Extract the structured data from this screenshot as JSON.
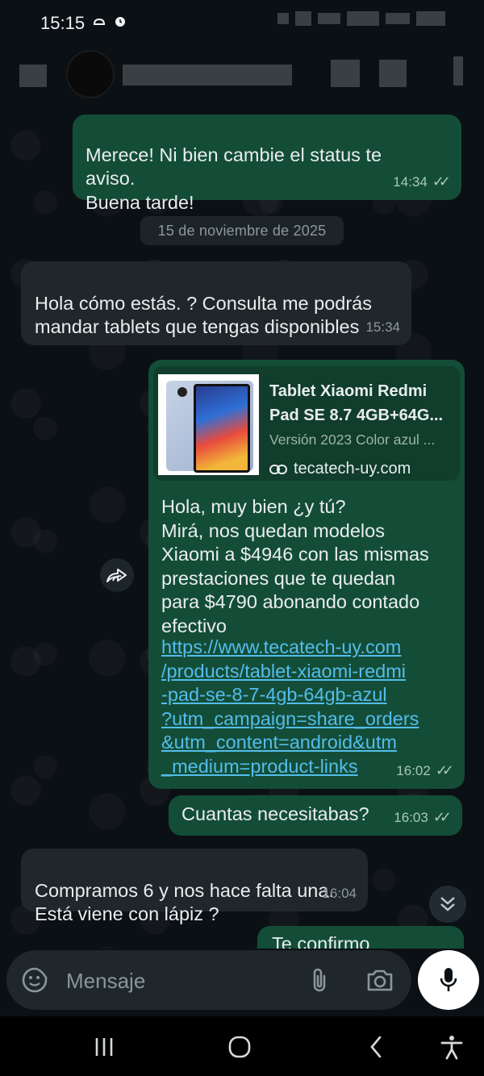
{
  "status_bar": {
    "time": "15:15"
  },
  "chat": {
    "date_separator": "15 de noviembre de 2025",
    "messages": [
      {
        "direction": "out",
        "text": "Merece! Ni bien cambie el status te\naviso.\nBuena tarde!",
        "time": "14:34"
      },
      {
        "direction": "in",
        "text": "Hola cómo estás. ? Consulta me podrás\nmandar tablets que tengas disponibles",
        "time": "15:34"
      },
      {
        "direction": "out",
        "preview": {
          "title": "Tablet Xiaomi Redmi\nPad SE 8.7 4GB+64G...",
          "subtitle": "Versión 2023 Color azul ...",
          "site": "tecatech-uy.com"
        },
        "text": "Hola, muy bien ¿y tú?\nMirá, nos quedan modelos\nXiaomi a $4946 con las mismas\nprestaciones que te quedan\npara $4790 abonando contado\nefectivo",
        "link": "https://www.tecatech-uy.com\n/products/tablet-xiaomi-redmi\n-pad-se-8-7-4gb-64gb-azul\n?utm_campaign=share_orders\n&utm_content=android&utm\n_medium=product-links",
        "time": "16:02"
      },
      {
        "direction": "out",
        "text": "Cuantas necesitabas?",
        "time": "16:03"
      },
      {
        "direction": "in",
        "text": "Compramos 6 y nos hace falta una.\nEstá viene con lápiz ?",
        "time": "16:04"
      },
      {
        "direction": "out",
        "text": "Te confirmo",
        "time": ""
      }
    ]
  },
  "input": {
    "placeholder": "Mensaje"
  },
  "colors": {
    "outgoing_bubble": "#144d37",
    "incoming_bubble": "#1f272a",
    "link": "#53bdeb",
    "background": "#0b1014"
  }
}
